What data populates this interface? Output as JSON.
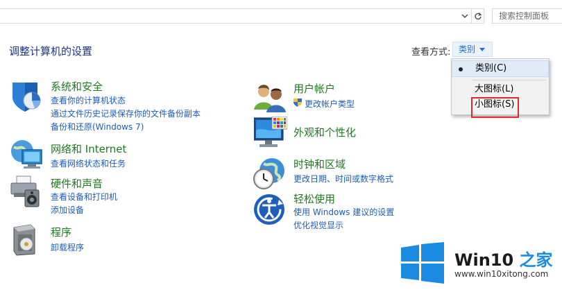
{
  "search": {
    "placeholder": "搜索控制面板"
  },
  "page_title": "调整计算机的设置",
  "view": {
    "label": "查看方式:",
    "selected": "类别",
    "menu": [
      {
        "label": "类别(C)",
        "selected": true
      },
      {
        "label": "大图标(L)",
        "selected": false
      },
      {
        "label": "小图标(S)",
        "selected": false
      }
    ]
  },
  "categories": {
    "security": {
      "title": "系统和安全",
      "links": [
        "查看你的计算机状态",
        "通过文件历史记录保存你的文件备份副本",
        "备份和还原(Windows 7)"
      ]
    },
    "network": {
      "title": "网络和 Internet",
      "links": [
        "查看网络状态和任务"
      ]
    },
    "hardware": {
      "title": "硬件和声音",
      "links": [
        "查看设备和打印机",
        "添加设备"
      ]
    },
    "programs": {
      "title": "程序",
      "links": [
        "卸载程序"
      ]
    },
    "users": {
      "title": "用户帐户",
      "links": [
        "更改帐户类型"
      ]
    },
    "appearance": {
      "title": "外观和个性化",
      "links": []
    },
    "clock": {
      "title": "时钟和区域",
      "links": [
        "更改日期、时间或数字格式"
      ]
    },
    "ease": {
      "title": "轻松使用",
      "links": [
        "使用 Windows 建议的设置",
        "优化视觉显示"
      ]
    }
  },
  "watermark": {
    "brand_a": "Win10 ",
    "brand_b": "之家",
    "url": "www.win10xitong.com"
  },
  "colors": {
    "title_blue": "#1e3287",
    "category_green": "#1f7a1f",
    "link_blue": "#1a5dbb",
    "win_blue": "#1a8be0",
    "highlight_red": "#e0262e"
  }
}
